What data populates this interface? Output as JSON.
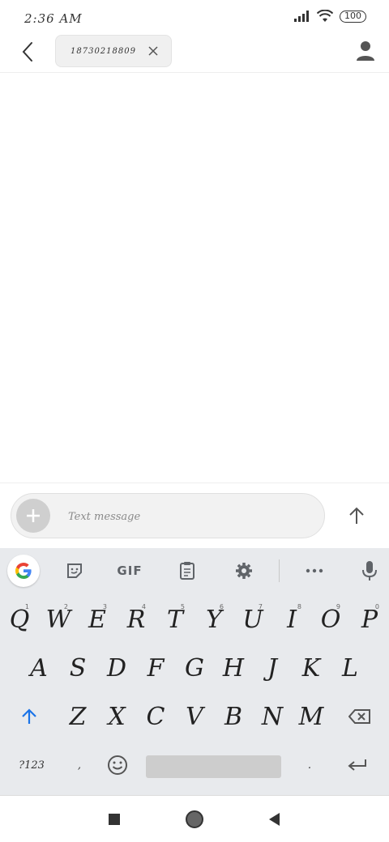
{
  "status_bar": {
    "time": "2:36 AM",
    "battery": "100"
  },
  "header": {
    "recipient": "18730218809"
  },
  "composer": {
    "placeholder": "Text message"
  },
  "keyboard": {
    "toolbar": {
      "gif_label": "GIF"
    },
    "row1": [
      {
        "label": "Q",
        "hint": "1"
      },
      {
        "label": "W",
        "hint": "2"
      },
      {
        "label": "E",
        "hint": "3"
      },
      {
        "label": "R",
        "hint": "4"
      },
      {
        "label": "T",
        "hint": "5"
      },
      {
        "label": "Y",
        "hint": "6"
      },
      {
        "label": "U",
        "hint": "7"
      },
      {
        "label": "I",
        "hint": "8"
      },
      {
        "label": "O",
        "hint": "9"
      },
      {
        "label": "P",
        "hint": "0"
      }
    ],
    "row2": [
      "A",
      "S",
      "D",
      "F",
      "G",
      "H",
      "J",
      "K",
      "L"
    ],
    "row3": [
      "Z",
      "X",
      "C",
      "V",
      "B",
      "N",
      "M"
    ],
    "row4": {
      "symbols_label": "?123",
      "comma": ",",
      "period": "."
    }
  },
  "colors": {
    "accent_blue": "#1a73e8",
    "keyboard_bg": "#e8eaed",
    "icon_gray": "#5f6368"
  }
}
